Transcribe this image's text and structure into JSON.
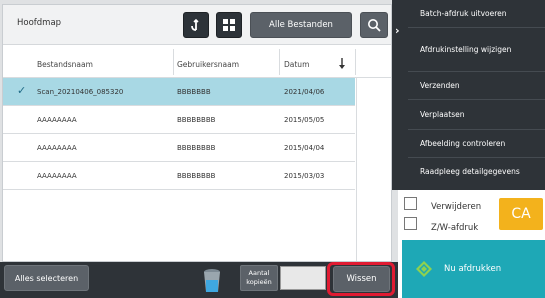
{
  "header": {
    "folder_title": "Hoofdmap",
    "filter_label": "Alle Bestanden"
  },
  "table": {
    "columns": [
      "Bestandsnaam",
      "Gebruikersnaam",
      "Datum"
    ],
    "rows": [
      {
        "name": "Scan_20210406_085320",
        "user": "BBBBBBB",
        "date": "2021/04/06",
        "selected": true
      },
      {
        "name": "AAAAAAAA",
        "user": "BBBBBBBB",
        "date": "2015/05/05",
        "selected": false
      },
      {
        "name": "AAAAAAAA",
        "user": "BBBBBBBB",
        "date": "2015/04/04",
        "selected": false
      },
      {
        "name": "AAAAAAAA",
        "user": "BBBBBBBB",
        "date": "2015/03/03",
        "selected": false
      }
    ]
  },
  "bottom": {
    "select_all_label": "Alles selecteren",
    "copies_label_line1": "Aantal",
    "copies_label_line2": "kopieën",
    "copies_value": "",
    "clear_label": "Wissen"
  },
  "menu": {
    "items": [
      "Batch-afdruk uitvoeren",
      "Afdrukinstelling wijzigen",
      "Verzenden",
      "Verplaatsen",
      "Afbeelding controleren",
      "Raadpleeg detailgegevens"
    ]
  },
  "options": {
    "delete_label": "Verwijderen",
    "bw_label": "Z/W-afdruk",
    "ca_label": "CA",
    "print_now_label": "Nu afdrukken"
  },
  "icons": [
    "refresh-icon",
    "grid-view-icon",
    "search-icon",
    "sort-desc-icon",
    "checkmark-icon",
    "chevron-right-icon",
    "trash-icon",
    "print-start-icon"
  ],
  "colors": {
    "selected_row": "#a8d8e4",
    "dark_panel": "#2e3338",
    "print_button": "#1ea8b6",
    "ca_button": "#f3b21c",
    "highlight": "#e01b32"
  }
}
